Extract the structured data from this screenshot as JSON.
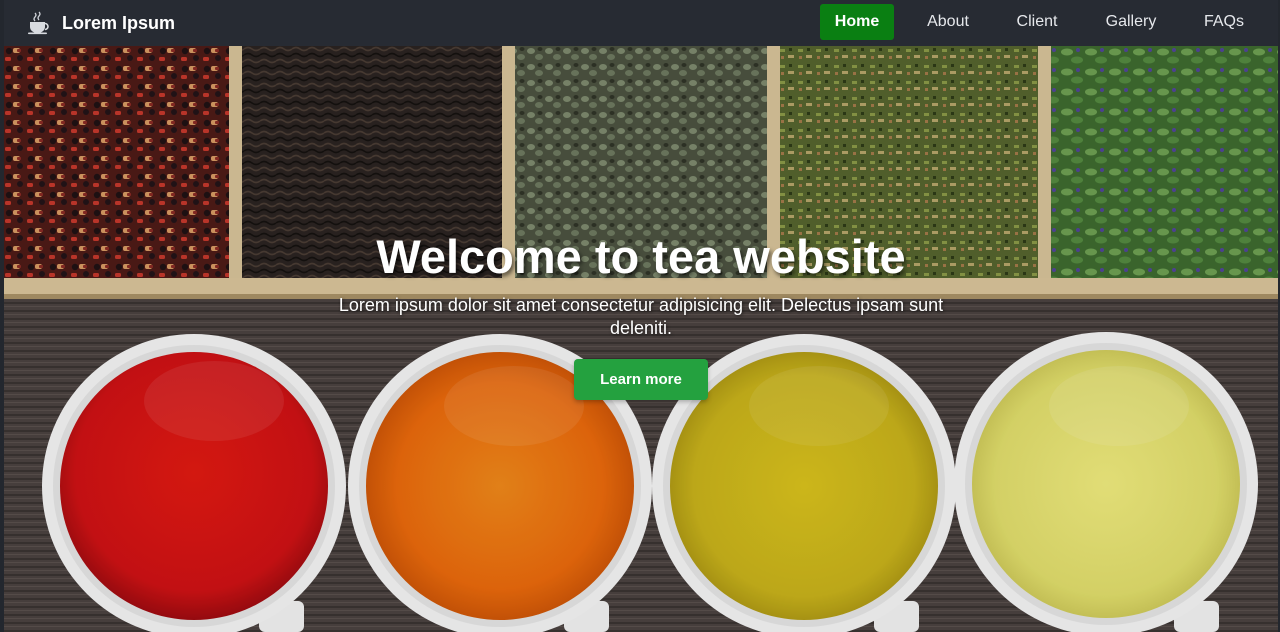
{
  "brand": {
    "name": "Lorem Ipsum",
    "icon": "teacup-icon"
  },
  "nav": {
    "items": [
      {
        "label": "Home",
        "active": true
      },
      {
        "label": "About",
        "active": false
      },
      {
        "label": "Client",
        "active": false
      },
      {
        "label": "Gallery",
        "active": false
      },
      {
        "label": "FAQs",
        "active": false
      }
    ]
  },
  "hero": {
    "title": "Welcome to tea website",
    "subtitle": "Lorem ipsum dolor sit amet consectetur adipisicing elit. Delectus ipsam sunt deleniti.",
    "button_label": "Learn more"
  },
  "colors": {
    "navbar": "#272b33",
    "active_nav": "#0a7f12",
    "cta": "#24a13f",
    "text": "#ffffff"
  }
}
